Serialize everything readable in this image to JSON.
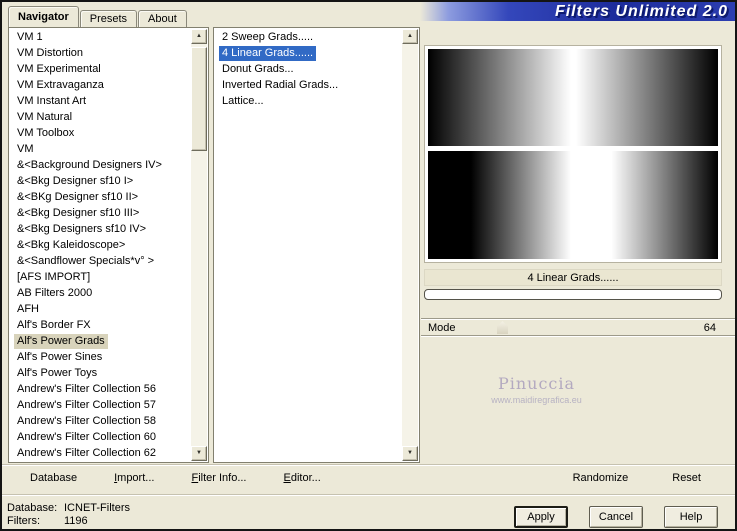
{
  "window": {
    "logo_text": "Filters Unlimited 2.0",
    "background": "#ece9d8",
    "selection_blue": "#316ac5",
    "selection_tan": "#d8d3bb",
    "logo_blue": "#1d2c9c"
  },
  "tabs": {
    "items": [
      "Navigator",
      "Presets",
      "About"
    ],
    "selected_index": 0
  },
  "navigator_list": {
    "items": [
      "VM 1",
      "VM Distortion",
      "VM Experimental",
      "VM Extravaganza",
      "VM Instant Art",
      "VM Natural",
      "VM Toolbox",
      "VM",
      "&<Background Designers IV>",
      "&<Bkg Designer sf10 I>",
      "&<BKg Designer sf10 II>",
      "&<Bkg Designer sf10 III>",
      "&<Bkg Designers sf10 IV>",
      "&<Bkg Kaleidoscope>",
      "&<Sandflower Specials*v° >",
      "[AFS IMPORT]",
      "AB Filters 2000",
      "AFH",
      "Alf's Border FX",
      "Alf's Power Grads",
      "Alf's Power Sines",
      "Alf's Power Toys",
      "Andrew's Filter Collection 56",
      "Andrew's Filter Collection 57",
      "Andrew's Filter Collection 58",
      "Andrew's Filter Collection 60",
      "Andrew's Filter Collection 62"
    ],
    "selected_index": 19
  },
  "filter_list": {
    "items": [
      "2 Sweep Grads.....",
      "4 Linear Grads......",
      "Donut Grads...",
      "Inverted Radial Grads...",
      "Lattice..."
    ],
    "selected_index": 1
  },
  "preview": {
    "caption": "4 Linear Grads......",
    "squares": [
      {
        "direction": "to right",
        "from": "#000000",
        "from_stop": "0%",
        "to": "#ffffff",
        "to_stop": "100%"
      },
      {
        "direction": "to right",
        "from": "#ffffff",
        "from_stop": "0%",
        "to": "#000000",
        "to_stop": "100%"
      },
      {
        "direction": "to right",
        "from": "#000000",
        "from_stop": "30%",
        "to": "#ffffff",
        "to_stop": "100%"
      },
      {
        "direction": "to right",
        "from": "#ffffff",
        "from_stop": "25%",
        "to": "#000000",
        "to_stop": "100%"
      }
    ],
    "watermark_line1": "Pinuccia",
    "watermark_line2": "www.maidiregrafica.eu"
  },
  "mode_control": {
    "label": "Mode",
    "value": "64"
  },
  "toolbar": {
    "left": {
      "items": [
        {
          "accel": "",
          "rest": "Database"
        },
        {
          "accel": "I",
          "rest": "mport..."
        },
        {
          "accel": "F",
          "rest": "ilter Info..."
        },
        {
          "accel": "E",
          "rest": "ditor..."
        }
      ]
    },
    "right": {
      "items": [
        {
          "accel": "",
          "rest": "Randomize"
        },
        {
          "accel": "",
          "rest": "Reset"
        }
      ]
    }
  },
  "status": {
    "database_label": "Database:",
    "database_value": "ICNET-Filters",
    "filters_label": "Filters:",
    "filters_value": "1196"
  },
  "action_buttons": {
    "apply": "Apply",
    "cancel": "Cancel",
    "help": "Help"
  }
}
